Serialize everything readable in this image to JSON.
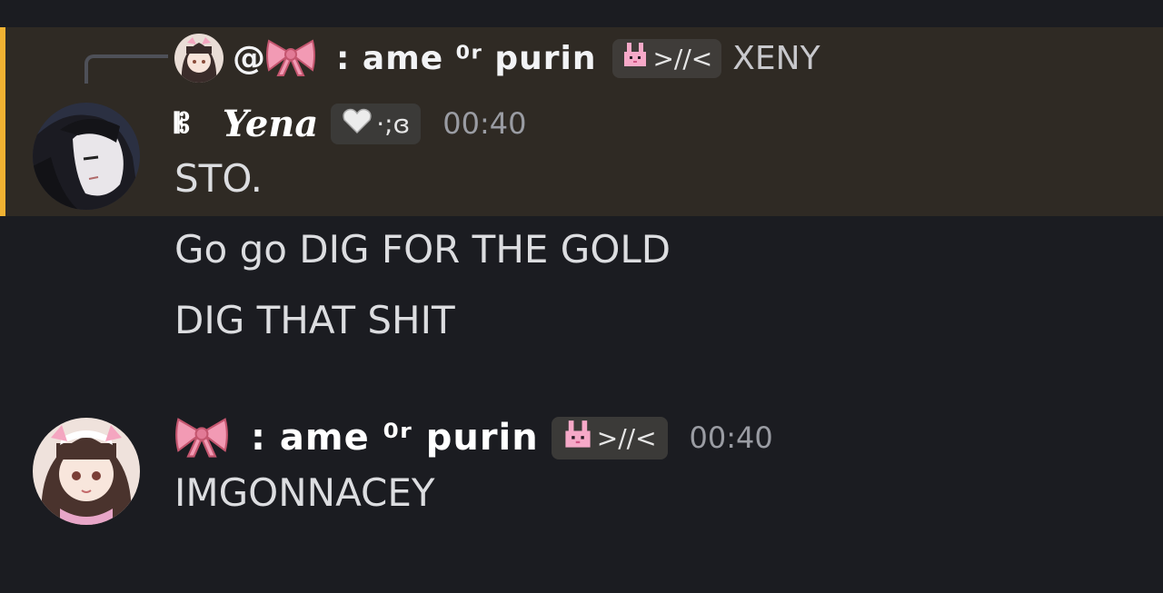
{
  "colors": {
    "background": "#1b1c21",
    "highlight": "#2f2a24",
    "accent": "#f0b232",
    "timestamp": "#9a9ca3",
    "reply_line": "#4e5058"
  },
  "reply": {
    "mention_prefix": "@",
    "author_display": ": ame  ⁰ʳ purin",
    "tag_text": ">//<",
    "preview_text": "XENY",
    "icons": [
      "bow-icon",
      "bunny-icon"
    ]
  },
  "messages": [
    {
      "author_badge": "𝄡",
      "author": "Yena",
      "clan_tag_text": "·;ɞ",
      "time": "00:40",
      "lines": [
        "STO.",
        "Go go  DIG FOR THE GOLD",
        "DIG THAT SHIT"
      ],
      "icons": [
        "heart-icon"
      ]
    },
    {
      "author_display": ": ame  ⁰ʳ purin",
      "clan_tag_text": ">//<",
      "time": "00:40",
      "lines": [
        "IMGONNACEY"
      ],
      "icons": [
        "bow-icon",
        "bunny-icon"
      ]
    }
  ]
}
